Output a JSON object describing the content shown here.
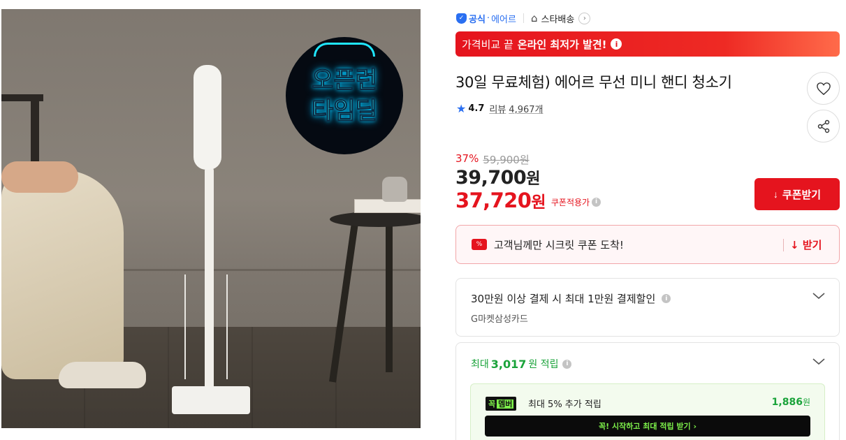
{
  "image": {
    "badge_lines": [
      "오픈런",
      "타임딜"
    ]
  },
  "seller": {
    "official_label": "공식",
    "dot": "·",
    "name": "에어르",
    "store_icon": "home-icon",
    "store_label": "스타배송",
    "chevron": "›"
  },
  "banner": {
    "text": "가격비교 끝",
    "highlight": "온라인 최저가 발견!",
    "info": "i",
    "color": "#e5141e"
  },
  "product": {
    "title": "30일 무료체험) 에어르 무선 미니 핸디 청소기",
    "rating_icon": "star-icon",
    "rating": "4.7",
    "review_label": "리뷰",
    "review_count": "4,967개"
  },
  "actions": {
    "wishlist_icon": "heart-icon",
    "share_icon": "share-icon"
  },
  "price": {
    "discount_rate": "37%",
    "original": "59,900원",
    "sale_amount": "39,700",
    "sale_unit": "원",
    "coupon_amount": "37,720",
    "coupon_unit": "원",
    "coupon_note": "쿠폰적용가",
    "info": "i"
  },
  "coupon_button": {
    "icon": "↓",
    "label": "쿠폰받기"
  },
  "secret_coupon": {
    "icon_text": "%",
    "text": "고객님께만 시크릿 쿠폰 도착!",
    "action_icon": "↓",
    "action_label": "받기"
  },
  "card_discount": {
    "title": "30만원 이상 결제 시 최대 1만원 결제할인",
    "info": "i",
    "subtitle": "G마켓삼성카드",
    "chevron": "⌄"
  },
  "points": {
    "prefix": "최대",
    "amount": "3,017",
    "suffix": "원 적립",
    "info": "i",
    "chevron": "⌄",
    "member": {
      "badge_a": "꼭",
      "badge_b": "멤버",
      "text": "최대 5% 추가 적립",
      "amount": "1,886",
      "unit": "원",
      "cta": "꼭! 시작하고 최대 적립 받기  ›"
    },
    "accent_color": "#1aa33a"
  }
}
